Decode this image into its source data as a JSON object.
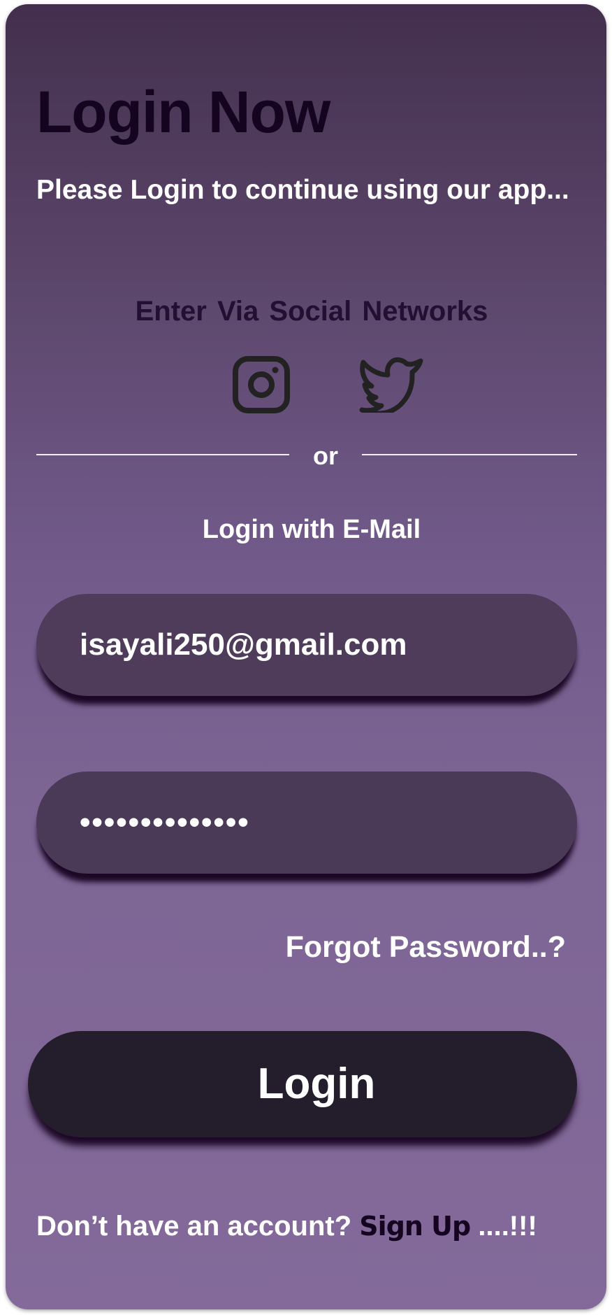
{
  "header": {
    "title": "Login Now",
    "subtitle": "Please Login to continue using our app..."
  },
  "social": {
    "heading": "Enter  Via Social Networks",
    "icons": [
      "instagram-icon",
      "twitter-icon"
    ],
    "icon_color": "#222222"
  },
  "divider": {
    "label": "or"
  },
  "email_section": {
    "heading": "Login with E-Mail"
  },
  "form": {
    "email_value": "isayali250@gmail.com",
    "password_value": "••••••••••••••",
    "forgot_label": "Forgot Password..?",
    "login_label": "Login"
  },
  "footer": {
    "prompt": "Don’t have an account? ",
    "signup_label": "Sign Up",
    "suffix": " ....!!!"
  },
  "colors": {
    "gradient_top": "#432f4d",
    "gradient_bottom": "#836a9a",
    "title": "#14041f",
    "button": "#241d2b",
    "field": "#4e3c5a",
    "shadow": "#1c0826"
  }
}
